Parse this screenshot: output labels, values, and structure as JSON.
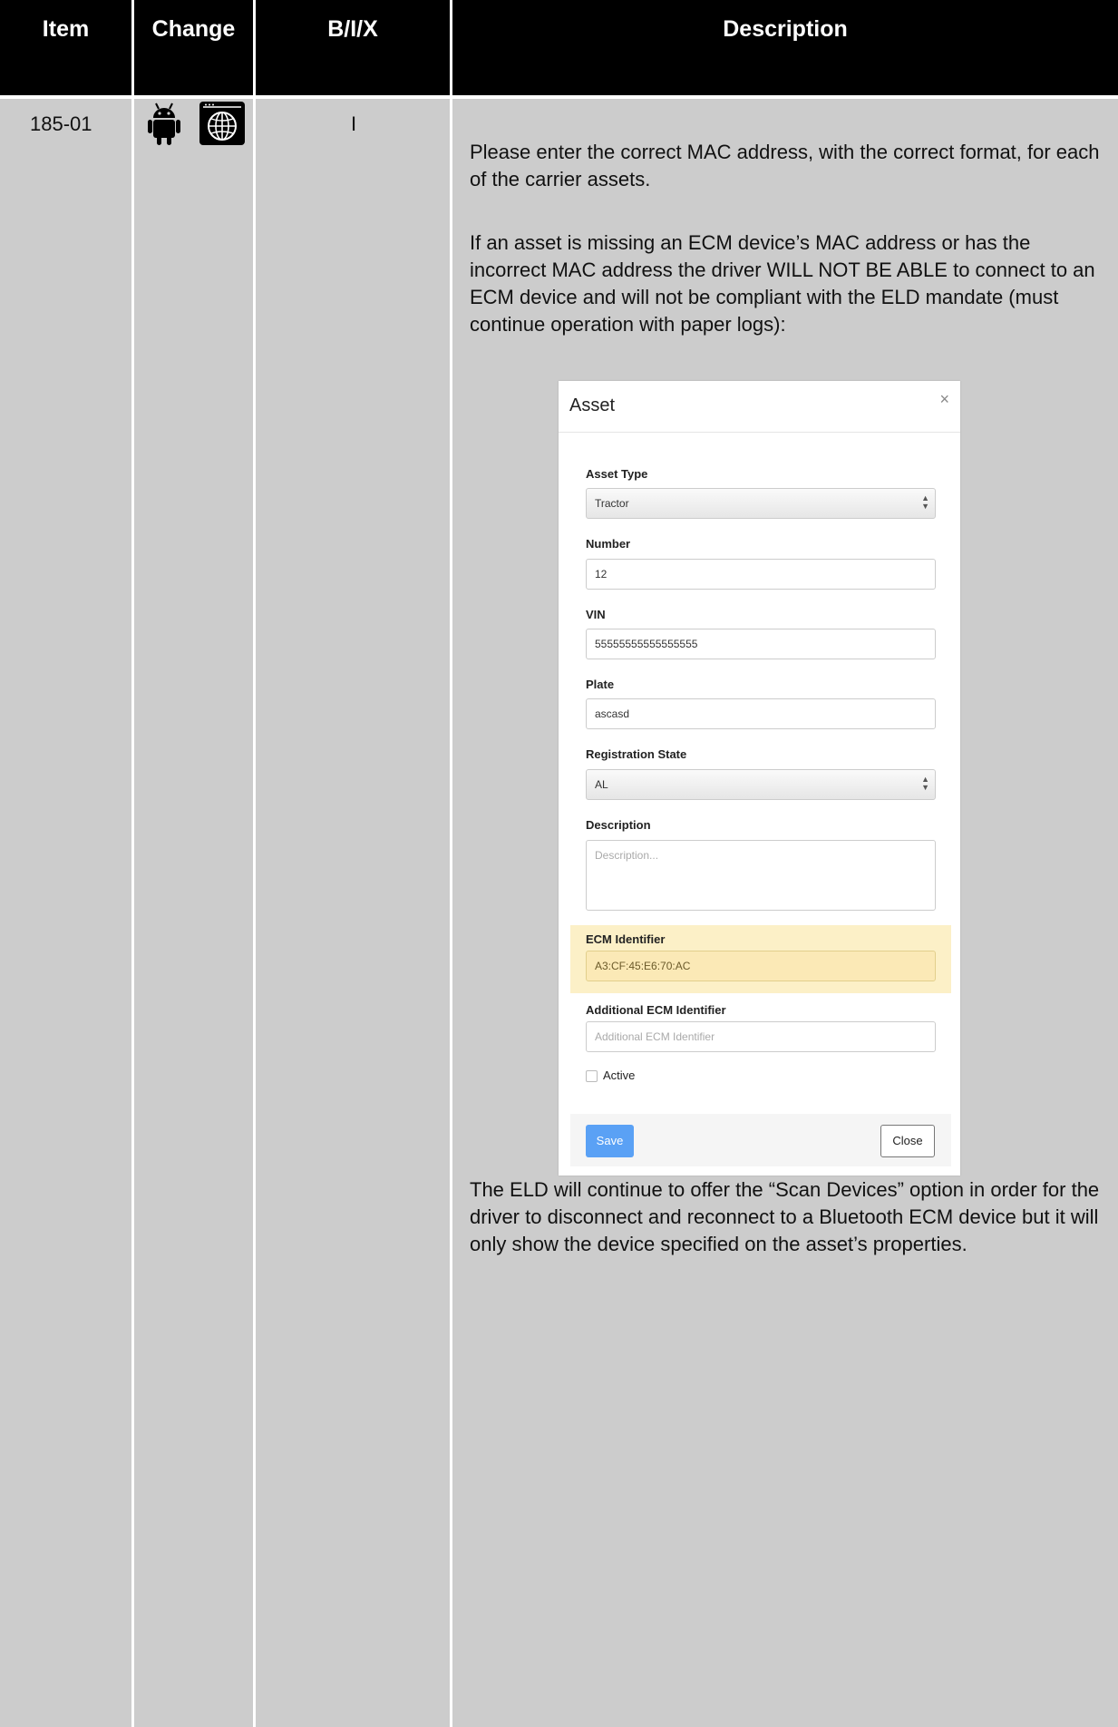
{
  "table": {
    "headers": {
      "item": "Item",
      "change": "Change",
      "bix": "B/I/X",
      "description": "Description"
    },
    "row": {
      "item": "185-01",
      "change_icons": [
        "android-icon",
        "web-globe-icon"
      ],
      "bix": "I",
      "paragraphs": [
        "Please enter the correct MAC address, with the correct format, for each of the carrier assets.",
        "If an asset is missing an ECM device’s MAC address or has the incorrect MAC address the driver WILL NOT BE ABLE to connect to an ECM device and will not be compliant with the ELD mandate (must continue operation with paper logs):",
        "The ELD will continue to offer the “Scan Devices” option in order for the driver to disconnect and reconnect to a Bluetooth ECM device but it will only show the device specified on the asset’s properties."
      ]
    }
  },
  "modal": {
    "title": "Asset",
    "close_symbol": "×",
    "fields": {
      "asset_type": {
        "label": "Asset Type",
        "value": "Tractor"
      },
      "number": {
        "label": "Number",
        "value": "12"
      },
      "vin": {
        "label": "VIN",
        "value": "55555555555555555"
      },
      "plate": {
        "label": "Plate",
        "value": "ascasd"
      },
      "registration_state": {
        "label": "Registration State",
        "value": "AL"
      },
      "description": {
        "label": "Description",
        "placeholder": "Description..."
      },
      "ecm_identifier": {
        "label": "ECM Identifier",
        "value": "A3:CF:45:E6:70:AC"
      },
      "additional_ecm": {
        "label": "Additional ECM Identifier",
        "placeholder": "Additional ECM Identifier"
      },
      "active": {
        "label": "Active",
        "checked": false
      }
    },
    "buttons": {
      "save": "Save",
      "close": "Close"
    },
    "colors": {
      "highlight": "#fcf0c7",
      "save_button": "#5aa1f5"
    }
  }
}
